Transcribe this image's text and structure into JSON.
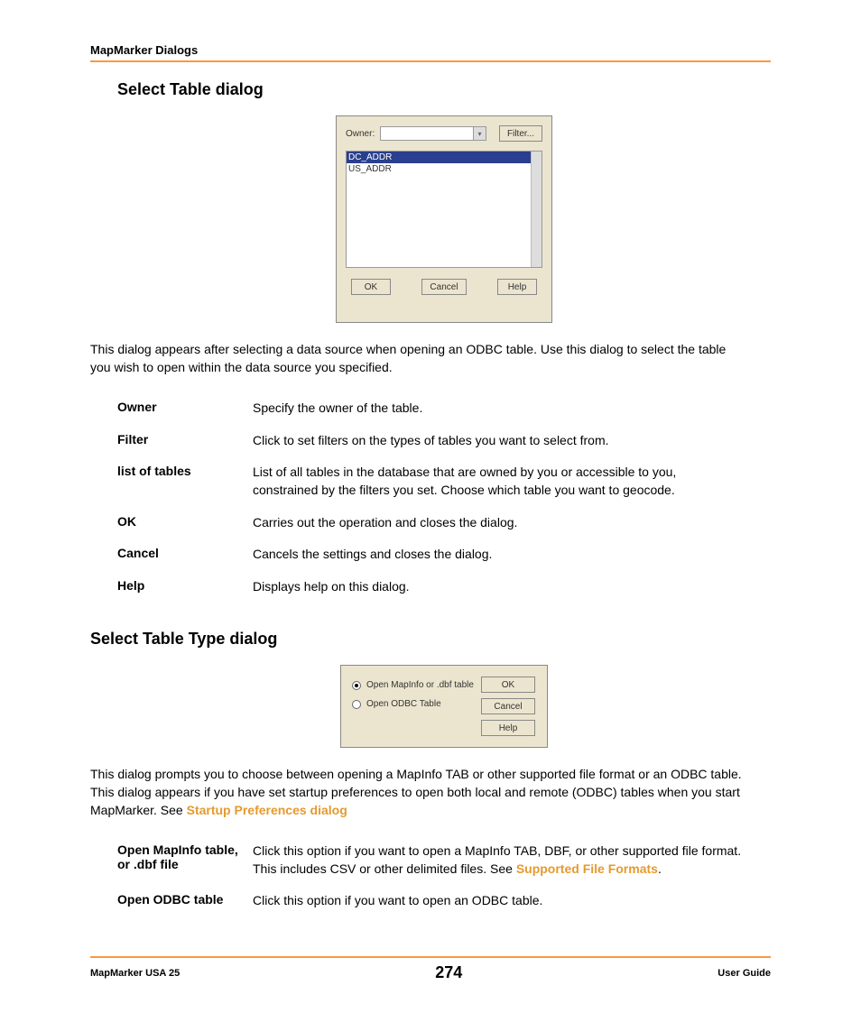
{
  "header": {
    "title": "MapMarker Dialogs"
  },
  "section1": {
    "heading": "Select Table dialog",
    "dialog": {
      "owner_label": "Owner:",
      "filter_btn": "Filter...",
      "list": {
        "item_selected": "DC_ADDR",
        "item_1": "US_ADDR"
      },
      "ok_btn": "OK",
      "cancel_btn": "Cancel",
      "help_btn": "Help"
    },
    "paragraph": "This dialog appears after selecting a data source when opening an ODBC table. Use this dialog to select the table you wish to open within the data source you specified.",
    "rows": [
      {
        "term": "Owner",
        "desc": "Specify the owner of the table."
      },
      {
        "term": "Filter",
        "desc": "Click to set filters on the types of tables you want to select from."
      },
      {
        "term": "list of tables",
        "desc": "List of all tables in the database that are owned by you or accessible to you, constrained by the filters you set. Choose which table you want to geocode."
      },
      {
        "term": "OK",
        "desc": "Carries out the operation and closes the dialog."
      },
      {
        "term": "Cancel",
        "desc": "Cancels the settings and closes the dialog."
      },
      {
        "term": "Help",
        "desc": "Displays help on this dialog."
      }
    ]
  },
  "section2": {
    "heading": "Select Table Type dialog",
    "dialog": {
      "opt1": "Open MapInfo or .dbf table",
      "opt2": "Open ODBC Table",
      "ok_btn": "OK",
      "cancel_btn": "Cancel",
      "help_btn": "Help"
    },
    "paragraph_pre": "This dialog prompts you to choose between opening a MapInfo TAB or other supported file format or an ODBC table. This dialog appears if you have set startup preferences to open both local and remote (ODBC) tables when you start MapMarker. See ",
    "paragraph_link": "Startup Preferences dialog",
    "rows": [
      {
        "term": "Open MapInfo table, or .dbf file",
        "desc_pre": "Click this option if you want to open a MapInfo TAB, DBF, or other supported file format. This includes CSV or other delimited files. See ",
        "desc_link": "Supported File Formats",
        "desc_post": "."
      },
      {
        "term": "Open ODBC table",
        "desc_pre": "Click this option if you want to open an ODBC table.",
        "desc_link": "",
        "desc_post": ""
      }
    ]
  },
  "footer": {
    "left": "MapMarker USA 25",
    "center": "274",
    "right": "User Guide"
  }
}
